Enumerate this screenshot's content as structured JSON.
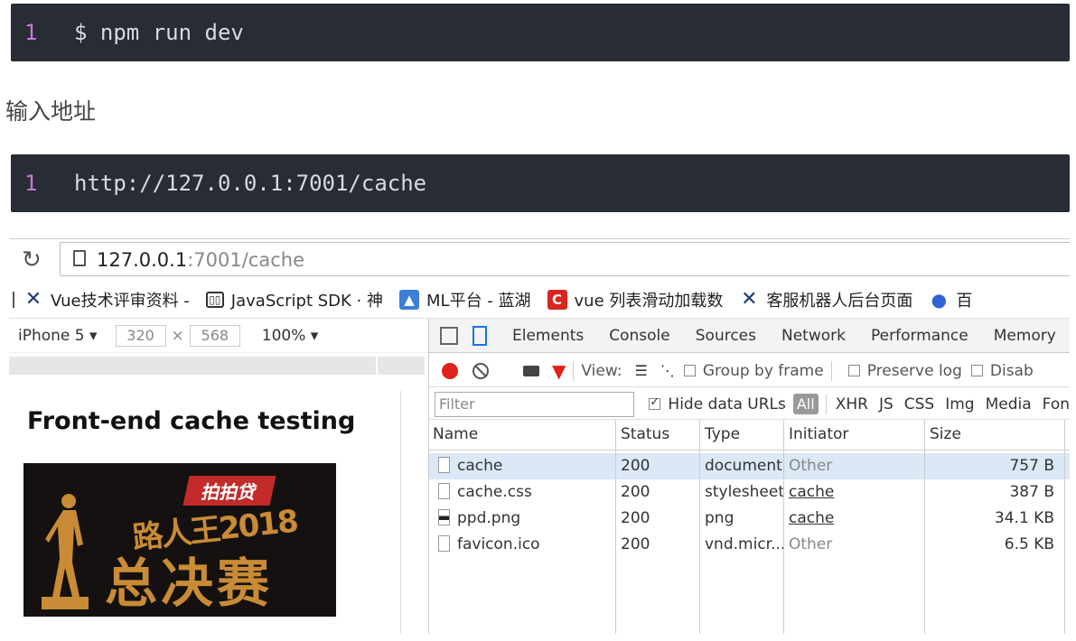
{
  "code_block_1": {
    "line_number": "1",
    "code": "$ npm run dev"
  },
  "prose": {
    "text": "输入地址"
  },
  "code_block_2": {
    "line_number": "1",
    "code": "http://127.0.0.1:7001/cache"
  },
  "browser": {
    "url_host": "127.0.0.1",
    "url_path": ":7001/cache",
    "bookmarks": [
      {
        "icon": "x-logo-icon",
        "label": "Vue技术评审资料 - "
      },
      {
        "icon": "book-icon",
        "label": "JavaScript SDK · 神"
      },
      {
        "icon": "ml-logo-icon",
        "label": "ML平台 - 蓝湖"
      },
      {
        "icon": "c-logo-icon",
        "label": "vue 列表滑动加载数"
      },
      {
        "icon": "x-logo-icon",
        "label": "客服机器人后台页面"
      },
      {
        "icon": "paw-icon",
        "label": "百"
      }
    ]
  },
  "device": {
    "name": "iPhone 5",
    "width": "320",
    "times": "×",
    "height": "568",
    "zoom": "100%"
  },
  "page": {
    "title": "Front-end cache testing",
    "poster_brand": "拍拍贷",
    "poster_line1": "路人王2018",
    "poster_line2": "总决赛"
  },
  "devtools": {
    "tabs": [
      "Elements",
      "Console",
      "Sources",
      "Network",
      "Performance",
      "Memory"
    ],
    "toolbar": {
      "view_label": "View:",
      "group_by_frame": "Group by frame",
      "preserve_log": "Preserve log",
      "disable": "Disab"
    },
    "filter": {
      "placeholder": "Filter",
      "hide_data_urls": "Hide data URLs",
      "types": [
        "All",
        "XHR",
        "JS",
        "CSS",
        "Img",
        "Media",
        "Fon"
      ]
    },
    "table": {
      "headers": {
        "name": "Name",
        "status": "Status",
        "type": "Type",
        "initiator": "Initiator",
        "size": "Size"
      },
      "rows": [
        {
          "name": "cache",
          "status": "200",
          "type": "document",
          "initiator": "Other",
          "size": "757 B"
        },
        {
          "name": "cache.css",
          "status": "200",
          "type": "stylesheet",
          "initiator": "cache",
          "size": "387 B"
        },
        {
          "name": "ppd.png",
          "status": "200",
          "type": "png",
          "initiator": "cache",
          "size": "34.1 KB"
        },
        {
          "name": "favicon.ico",
          "status": "200",
          "type": "vnd.micr...",
          "initiator": "Other",
          "size": "6.5 KB"
        }
      ]
    }
  },
  "colors": {
    "code_bg": "#282c34",
    "line_number": "#c678dd",
    "record": "#e0201b",
    "selected_row": "#dbe8f6"
  }
}
